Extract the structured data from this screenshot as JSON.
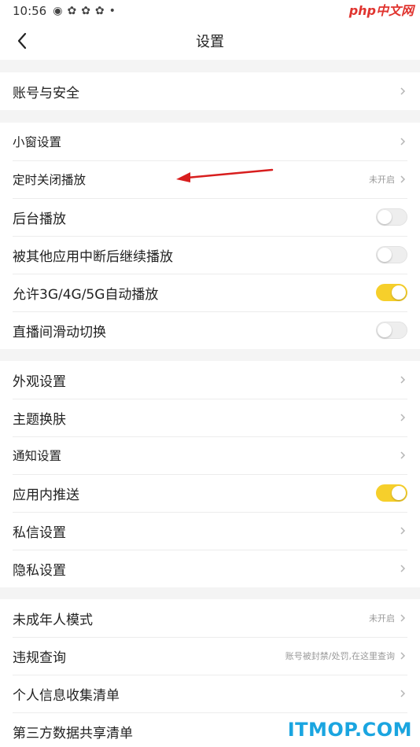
{
  "status_bar": {
    "time": "10:56",
    "icons": [
      "weibo-icon",
      "app-icon",
      "app-icon",
      "app-icon"
    ],
    "dot": "•"
  },
  "watermark_top": "php中文网",
  "header": {
    "title": "设置"
  },
  "groups": [
    {
      "rows": [
        {
          "label": "账号与安全",
          "type": "link"
        }
      ]
    },
    {
      "rows": [
        {
          "label": "小窗设置",
          "type": "link"
        },
        {
          "label": "定时关闭播放",
          "type": "link",
          "value": "未开启"
        },
        {
          "label": "后台播放",
          "type": "toggle",
          "on": false
        },
        {
          "label": "被其他应用中断后继续播放",
          "type": "toggle",
          "on": false
        },
        {
          "label": "允许3G/4G/5G自动播放",
          "type": "toggle",
          "on": true
        },
        {
          "label": "直播间滑动切换",
          "type": "toggle",
          "on": false
        }
      ]
    },
    {
      "rows": [
        {
          "label": "外观设置",
          "type": "link"
        },
        {
          "label": "主题换肤",
          "type": "link"
        },
        {
          "label": "通知设置",
          "type": "link"
        },
        {
          "label": "应用内推送",
          "type": "toggle",
          "on": true
        },
        {
          "label": "私信设置",
          "type": "link"
        },
        {
          "label": "隐私设置",
          "type": "link"
        }
      ]
    },
    {
      "rows": [
        {
          "label": "未成年人模式",
          "type": "link",
          "value": "未开启"
        },
        {
          "label": "违规查询",
          "type": "link",
          "value": "账号被封禁/处罚,在这里查询"
        },
        {
          "label": "个人信息收集清单",
          "type": "link"
        },
        {
          "label": "第三方数据共享清单",
          "type": "link"
        }
      ]
    }
  ],
  "colors": {
    "toggle_on": "#f6cf2b",
    "annotation_arrow": "#d81e1e",
    "background_gap": "#f4f4f4"
  },
  "watermark_bottom": "ITMOP.COM"
}
